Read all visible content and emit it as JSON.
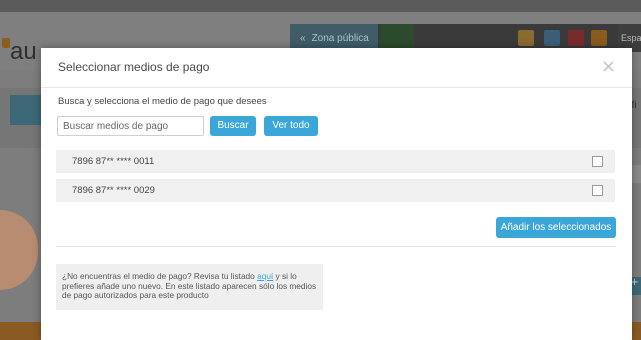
{
  "background": {
    "logo_text": "au",
    "nav_public_label": "Zona pública",
    "language_label": "Espa",
    "right_side_text": "áfi",
    "plus_label": "+"
  },
  "modal": {
    "title": "Seleccionar medios de pago",
    "close_glyph": "×",
    "instructions": "Busca y selecciona el medio de pago que desees",
    "search_placeholder": "Buscar medios de pago",
    "search_button": "Buscar",
    "view_all_button": "Ver todo",
    "payment_methods": [
      {
        "label": "7896 87** **** 0011",
        "checked": false
      },
      {
        "label": "7896 87** **** 0029",
        "checked": false
      }
    ],
    "add_selected_button": "Añadir los seleccionados",
    "note": {
      "before_link": "¿No encuentras el medio de pago? Revisa tu listado ",
      "link_text": "aquí",
      "after_link": " y si lo prefieres añade uno nuevo. En este listado aparecen sólo los medios de pago autorizados para este producto"
    }
  },
  "colors": {
    "accent": "#3ba7d8",
    "overlay": "#7d7d7d"
  }
}
